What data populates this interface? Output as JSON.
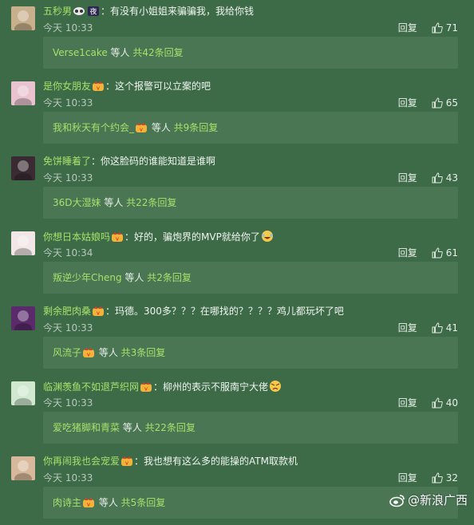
{
  "comments": [
    {
      "username": "五秒男",
      "badges": [
        "eye-mask-icon",
        "night-badge-icon"
      ],
      "text": "：有没有小姐姐来骗骗我，我给你钱",
      "time": "今天 10:33",
      "reply_label": "回复",
      "likes": "71",
      "replies": {
        "who": "Verse1cake",
        "mid": " 等人 ",
        "count": "共42条回复",
        "who_badge": false
      },
      "avatar_color": "#c9b08c"
    },
    {
      "username": "是你女朋友",
      "badges": [
        "vip-crown-icon"
      ],
      "text": "：这个报警可以立案的吧",
      "time": "今天 10:33",
      "reply_label": "回复",
      "likes": "65",
      "replies": {
        "who": "我和秋天有个约会_",
        "mid": " 等人 ",
        "count": "共9条回复",
        "who_badge": true
      },
      "avatar_color": "#e9c4d0"
    },
    {
      "username": "免饼睡着了",
      "badges": [],
      "text": "：你这脸码的谁能知道是谁啊",
      "time": "今天 10:33",
      "reply_label": "回复",
      "likes": "43",
      "replies": {
        "who": "36D大湿妹",
        "mid": " 等人 ",
        "count": "共22条回复",
        "who_badge": false
      },
      "avatar_color": "#3a2b32"
    },
    {
      "username": "你想日本姑娘吗",
      "badges": [
        "vip-crown-icon"
      ],
      "text": "：好的，骗炮界的MVP就给你了",
      "text_emoji": true,
      "time": "今天 10:34",
      "reply_label": "回复",
      "likes": "61",
      "replies": {
        "who": "叛逆少年Cheng",
        "mid": " 等人 ",
        "count": "共2条回复",
        "who_badge": false
      },
      "avatar_color": "#f2e6e6"
    },
    {
      "username": "剩余肥肉桑",
      "badges": [
        "vip-crown-icon"
      ],
      "text": "：玛德。300多？？？在哪找的？？？？鸡儿都玩坏了吧",
      "time": "今天 10:33",
      "reply_label": "回复",
      "likes": "41",
      "replies": {
        "who": "风流子",
        "mid": " 等人 ",
        "count": "共3条回复",
        "who_badge": true
      },
      "avatar_color": "#5a2a6a"
    },
    {
      "username": "临渊羡鱼不如退芦织网",
      "badges": [
        "vip-crown-icon"
      ],
      "text": "：柳州的表示不服南宁大佬",
      "text_emoji2": true,
      "time": "今天 10:33",
      "reply_label": "回复",
      "likes": "40",
      "replies": {
        "who": "爱吃猪脚和青菜",
        "mid": " 等人 ",
        "count": "共22条回复",
        "who_badge": false
      },
      "avatar_color": "#cfe8cf"
    },
    {
      "username": "你再闹我也会宠爱",
      "badges": [
        "vip-crown-icon"
      ],
      "text": "：我也想有这么多的能操的ATM取款机",
      "time": "今天 10:33",
      "reply_label": "回复",
      "likes": "32",
      "replies": {
        "who": "肉诗主",
        "mid": " 等人 ",
        "count": "共5条回复",
        "who_badge": true
      },
      "avatar_color": "#d8b89a"
    }
  ],
  "watermark": {
    "text": "@新浪广西"
  }
}
